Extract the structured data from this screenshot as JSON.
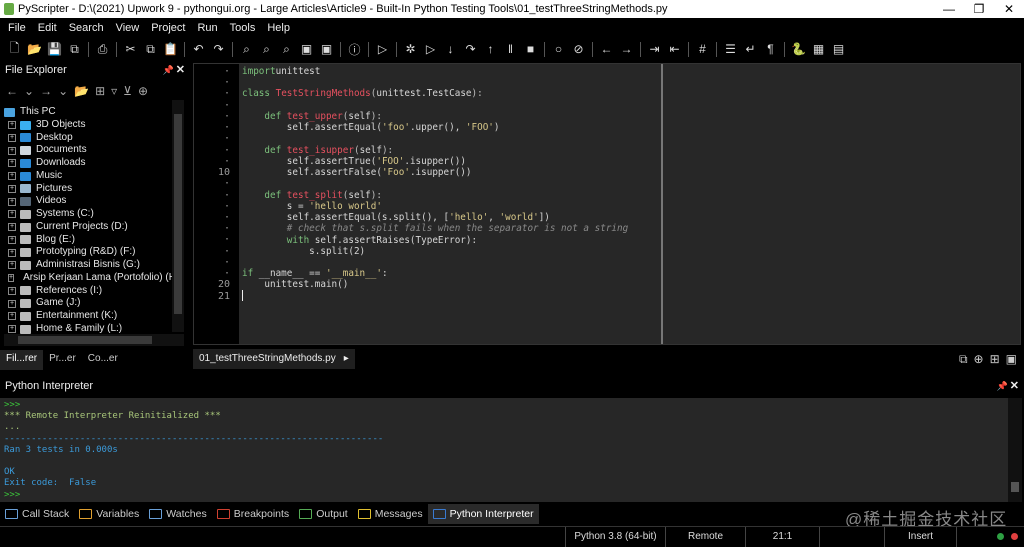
{
  "window": {
    "title": "PyScripter - D:\\(2021) Upwork 9 - pythongui.org - Large Articles\\Article9 - Built-In Python Testing Tools\\01_testThreeStringMethods.py",
    "minimize": "—",
    "maximize": "❐",
    "close": "✕"
  },
  "menu": [
    "File",
    "Edit",
    "Search",
    "View",
    "Project",
    "Run",
    "Tools",
    "Help"
  ],
  "toolbar": [
    {
      "name": "new-file",
      "glyph": "🗋"
    },
    {
      "name": "open-file",
      "glyph": "📂"
    },
    {
      "name": "save",
      "glyph": "💾"
    },
    {
      "name": "save-all",
      "glyph": "⧉"
    },
    {
      "sep": true
    },
    {
      "name": "print",
      "glyph": "⎙"
    },
    {
      "sep": true
    },
    {
      "name": "cut",
      "glyph": "✂"
    },
    {
      "name": "copy",
      "glyph": "⧉"
    },
    {
      "name": "paste",
      "glyph": "📋"
    },
    {
      "sep": true
    },
    {
      "name": "undo",
      "glyph": "↶"
    },
    {
      "name": "redo",
      "glyph": "↷"
    },
    {
      "sep": true
    },
    {
      "name": "find",
      "glyph": "⌕"
    },
    {
      "name": "find-in-files",
      "glyph": "⌕"
    },
    {
      "name": "replace",
      "glyph": "⌕"
    },
    {
      "name": "find-folder",
      "glyph": "▣"
    },
    {
      "name": "find-window",
      "glyph": "▣"
    },
    {
      "sep": true
    },
    {
      "name": "info",
      "glyph": "ⓘ"
    },
    {
      "sep": true
    },
    {
      "name": "run",
      "glyph": "▷"
    },
    {
      "sep": true
    },
    {
      "name": "debug",
      "glyph": "✲"
    },
    {
      "name": "run-to-cursor",
      "glyph": "▷"
    },
    {
      "name": "step-into",
      "glyph": "↓"
    },
    {
      "name": "step-over",
      "glyph": "↷"
    },
    {
      "name": "step-out",
      "glyph": "↑"
    },
    {
      "name": "pause",
      "glyph": "‖"
    },
    {
      "name": "abort",
      "glyph": "■"
    },
    {
      "sep": true
    },
    {
      "name": "toggle-breakpoint",
      "glyph": "○"
    },
    {
      "name": "clear-breakpoints",
      "glyph": "⊘"
    },
    {
      "sep": true
    },
    {
      "name": "back",
      "glyph": "←"
    },
    {
      "name": "forward",
      "glyph": "→"
    },
    {
      "sep": true
    },
    {
      "name": "indent",
      "glyph": "⇥"
    },
    {
      "name": "dedent",
      "glyph": "⇤"
    },
    {
      "sep": true
    },
    {
      "name": "grid",
      "glyph": "#"
    },
    {
      "sep": true
    },
    {
      "name": "list",
      "glyph": "☰"
    },
    {
      "name": "word-wrap",
      "glyph": "↵"
    },
    {
      "name": "pilcrow",
      "glyph": "¶"
    },
    {
      "sep": true
    },
    {
      "name": "python",
      "glyph": "🐍"
    },
    {
      "name": "layout",
      "glyph": "▦"
    },
    {
      "name": "layout-menu",
      "glyph": "▤"
    }
  ],
  "explorer": {
    "title": "File Explorer",
    "pin": "📌",
    "close": "✕",
    "tools": [
      "←",
      "⌄",
      "→",
      "⌄",
      "📂",
      "⊞",
      "▿",
      "⊻",
      "⊕"
    ],
    "items": [
      {
        "label": "This PC",
        "root": true,
        "color": "#4aa3e0"
      },
      {
        "label": "3D Objects",
        "color": "#3ab0f0"
      },
      {
        "label": "Desktop",
        "color": "#2a8ad8"
      },
      {
        "label": "Documents",
        "color": "#cfd8e0"
      },
      {
        "label": "Downloads",
        "color": "#2a8ad8"
      },
      {
        "label": "Music",
        "color": "#2a8ad8"
      },
      {
        "label": "Pictures",
        "color": "#9ab8d0"
      },
      {
        "label": "Videos",
        "color": "#556677"
      },
      {
        "label": "Systems (C:)",
        "color": "#bbb"
      },
      {
        "label": "Current Projects (D:)",
        "color": "#bbb"
      },
      {
        "label": "Blog (E:)",
        "color": "#bbb"
      },
      {
        "label": "Prototyping (R&D) (F:)",
        "color": "#bbb"
      },
      {
        "label": "Administrasi Bisnis (G:)",
        "color": "#bbb"
      },
      {
        "label": "Arsip Kerjaan Lama (Portofolio) (H:)",
        "color": "#bbb"
      },
      {
        "label": "References (I:)",
        "color": "#bbb"
      },
      {
        "label": "Game (J:)",
        "color": "#bbb"
      },
      {
        "label": "Entertainment (K:)",
        "color": "#bbb"
      },
      {
        "label": "Home & Family (L:)",
        "color": "#bbb"
      }
    ],
    "tabs": [
      "Fil...rer",
      "Pr...er",
      "Co...er"
    ]
  },
  "editor": {
    "gutter": [
      "·",
      "·",
      "·",
      "·",
      "·",
      "·",
      "·",
      "·",
      "·",
      "10",
      "·",
      "·",
      "·",
      "·",
      "·",
      "·",
      "·",
      "·",
      "·",
      "20",
      "21"
    ],
    "lines": [
      [
        [
          "kw",
          "import"
        ],
        [
          "",
          "unittest"
        ]
      ],
      [],
      [
        [
          "kw",
          "class "
        ],
        [
          "fn",
          "TestStringMethods"
        ],
        [
          "pu",
          "("
        ],
        [
          "",
          "unittest.TestCase"
        ],
        [
          "pu",
          "):"
        ]
      ],
      [],
      [
        [
          "",
          "    "
        ],
        [
          "kw",
          "def "
        ],
        [
          "fn",
          "test_upper"
        ],
        [
          "pu",
          "("
        ],
        [
          "",
          "self"
        ],
        [
          "pu",
          "):"
        ]
      ],
      [
        [
          "",
          "        self.assertEqual("
        ],
        [
          "st",
          "'foo'"
        ],
        [
          "",
          ".upper(), "
        ],
        [
          "st",
          "'FOO'"
        ],
        [
          "",
          ")"
        ]
      ],
      [],
      [
        [
          "",
          "    "
        ],
        [
          "kw",
          "def "
        ],
        [
          "fn",
          "test_isupper"
        ],
        [
          "pu",
          "("
        ],
        [
          "",
          "self"
        ],
        [
          "pu",
          "):"
        ]
      ],
      [
        [
          "",
          "        self.assertTrue("
        ],
        [
          "st",
          "'FOO'"
        ],
        [
          "",
          ".isupper())"
        ]
      ],
      [
        [
          "",
          "        self.assertFalse("
        ],
        [
          "st",
          "'Foo'"
        ],
        [
          "",
          ".isupper())"
        ]
      ],
      [],
      [
        [
          "",
          "    "
        ],
        [
          "kw",
          "def "
        ],
        [
          "fn",
          "test_split"
        ],
        [
          "pu",
          "("
        ],
        [
          "",
          "self"
        ],
        [
          "pu",
          "):"
        ]
      ],
      [
        [
          "",
          "        s = "
        ],
        [
          "st",
          "'hello world'"
        ]
      ],
      [
        [
          "",
          "        self.assertEqual(s.split(), ["
        ],
        [
          "st",
          "'hello'"
        ],
        [
          "",
          ", "
        ],
        [
          "st",
          "'world'"
        ],
        [
          "",
          "])"
        ]
      ],
      [
        [
          "",
          "        "
        ],
        [
          "cm",
          "# check that s.split fails when the separator is not a string"
        ]
      ],
      [
        [
          "",
          "        "
        ],
        [
          "kw",
          "with "
        ],
        [
          "",
          "self.assertRaises(TypeError):"
        ]
      ],
      [
        [
          "",
          "            s.split(2)"
        ]
      ],
      [],
      [
        [
          "kw",
          "if "
        ],
        [
          "",
          "__name__ == "
        ],
        [
          "st",
          "'__main__'"
        ],
        [
          "",
          ":"
        ]
      ],
      [
        [
          "",
          "    unittest.main()"
        ]
      ],
      []
    ],
    "tab_label": "01_testThreeStringMethods.py",
    "tab_close": "▸",
    "tab_icons": [
      "⧉",
      "⊕",
      "⊞",
      "▣"
    ]
  },
  "interpreter": {
    "title": "Python Interpreter",
    "pin": "📌",
    "close": "✕",
    "lines": [
      {
        "cls": "prompt",
        "text": ">>>"
      },
      {
        "cls": "sys",
        "text": "*** Remote Interpreter Reinitialized ***"
      },
      {
        "cls": "sys",
        "text": "..."
      },
      {
        "cls": "blue",
        "text": "----------------------------------------------------------------------"
      },
      {
        "cls": "blue",
        "text": "Ran 3 tests in 0.000s"
      },
      {
        "cls": "blue",
        "text": ""
      },
      {
        "cls": "blue",
        "text": "OK"
      },
      {
        "cls": "blue",
        "text": "Exit code:  False"
      },
      {
        "cls": "prompt",
        "text": ">>>"
      }
    ]
  },
  "bottom_tabs": [
    {
      "label": "Call Stack",
      "color": "#6aa0d8"
    },
    {
      "label": "Variables",
      "color": "#e0a030"
    },
    {
      "label": "Watches",
      "color": "#6aa0d8"
    },
    {
      "label": "Breakpoints",
      "color": "#d04030"
    },
    {
      "label": "Output",
      "color": "#5a5"
    },
    {
      "label": "Messages",
      "color": "#e0c030"
    },
    {
      "label": "Python Interpreter",
      "color": "#3a7ad0",
      "active": true
    }
  ],
  "watermark": "@稀土掘金技术社区",
  "status": {
    "python": "Python 3.8 (64-bit)",
    "engine": "Remote",
    "position": "21:1",
    "mode": "Insert",
    "colors": {
      "ok": "#2ea043",
      "error": "#e04040"
    }
  }
}
